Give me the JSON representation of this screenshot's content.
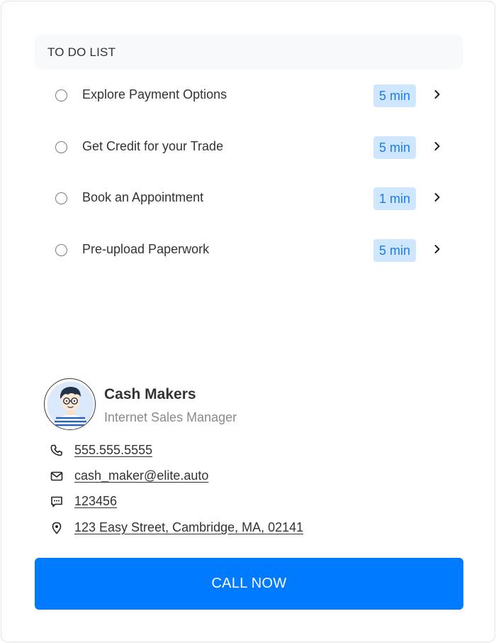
{
  "todo": {
    "header": "TO DO LIST",
    "items": [
      {
        "label": "Explore Payment Options",
        "time": "5 min"
      },
      {
        "label": "Get Credit for your Trade",
        "time": "5 min"
      },
      {
        "label": "Book an Appointment",
        "time": "1 min"
      },
      {
        "label": "Pre-upload Paperwork",
        "time": "5 min"
      }
    ]
  },
  "contact": {
    "name": "Cash Makers",
    "title": "Internet Sales Manager",
    "phone": "555.555.5555",
    "email": "cash_maker@elite.auto",
    "sms": "123456",
    "address": "123 Easy Street, Cambridge, MA, 02141",
    "icons": {
      "phone": "phone-icon",
      "email": "envelope-icon",
      "sms": "chat-bubble-icon",
      "address": "map-pin-icon"
    }
  },
  "cta": {
    "label": "CALL NOW"
  },
  "colors": {
    "accent": "#007bff",
    "badge_bg": "#cfe6ff",
    "badge_text": "#1c7ce6",
    "header_bg": "#f8f9fb"
  }
}
